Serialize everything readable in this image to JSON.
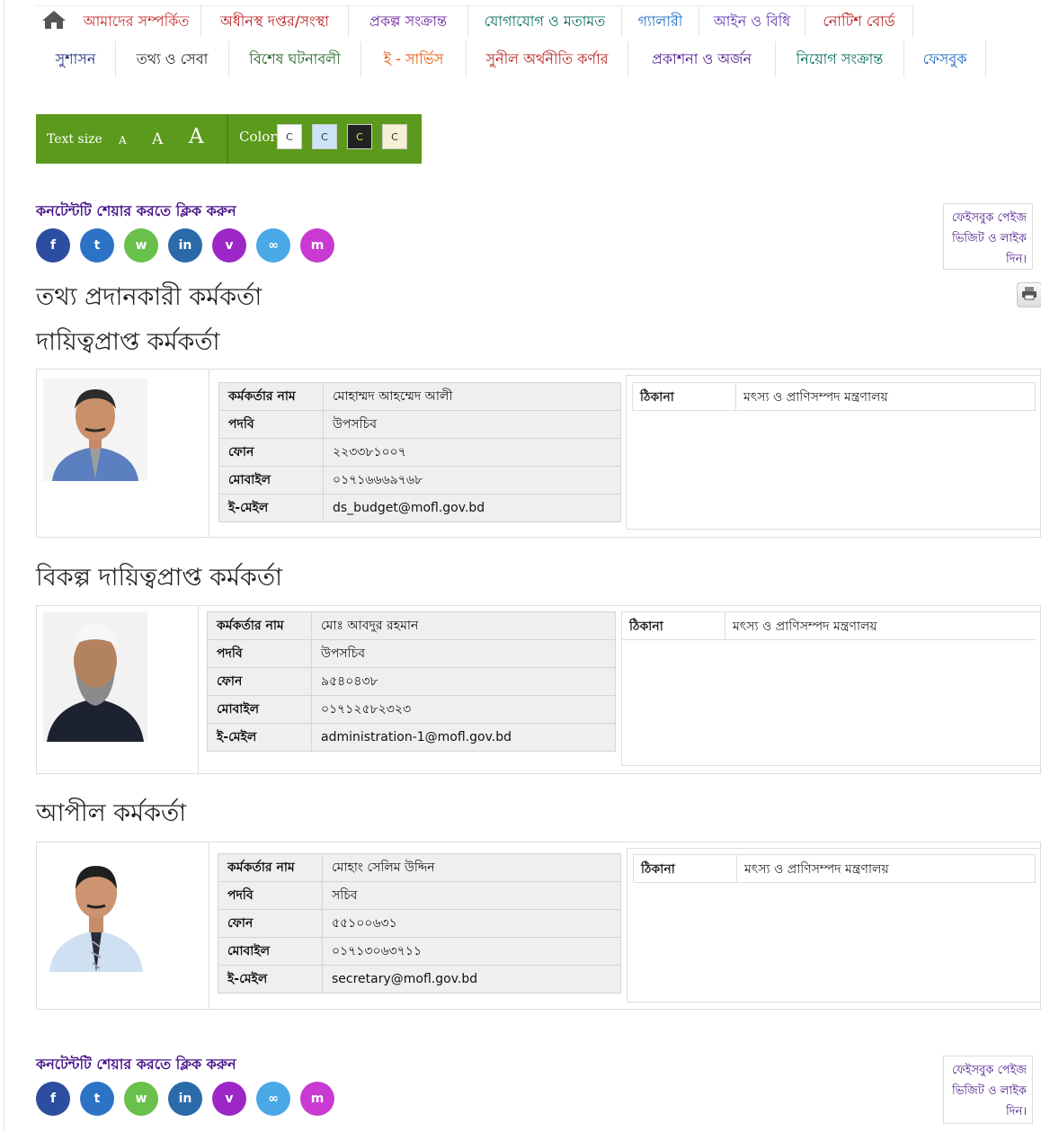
{
  "nav": {
    "row1": [
      {
        "label": "আমাদের সম্পর্কিত",
        "color": "#c62828"
      },
      {
        "label": "অধীনস্থ দপ্তর/সংস্থা",
        "color": "#b71c1c"
      },
      {
        "label": "প্রকল্প সংক্রান্ত",
        "color": "#6a1b9a"
      },
      {
        "label": "যোগাযোগ ও মতামত",
        "color": "#00695c"
      },
      {
        "label": "গ্যালারী",
        "color": "#1565c0"
      },
      {
        "label": "আইন ও বিধি",
        "color": "#5e35b1"
      },
      {
        "label": "নোটিশ বোর্ড",
        "color": "#b71c1c"
      }
    ],
    "row2": [
      {
        "label": "সুশাসন",
        "color": "#1a237e"
      },
      {
        "label": "তথ্য ও সেবা",
        "color": "#212121"
      },
      {
        "label": "বিশেষ ঘটনাবলী",
        "color": "#1b5e20"
      },
      {
        "label": "ই - সার্ভিস",
        "color": "#e65100"
      },
      {
        "label": "সুনীল অর্থনীতি কর্ণার",
        "color": "#b71c1c"
      },
      {
        "label": "প্রকাশনা ও অর্জন",
        "color": "#4a148c"
      },
      {
        "label": "নিয়োগ সংক্রান্ত",
        "color": "#00695c"
      },
      {
        "label": "ফেসবুক",
        "color": "#1565c0"
      }
    ]
  },
  "toolbar": {
    "text_size_label": "Text size",
    "size_small": "A",
    "size_medium": "A",
    "size_large": "A",
    "color_label": "Color",
    "swatches": [
      {
        "label": "C",
        "bg": "#ffffff",
        "fg": "#333333"
      },
      {
        "label": "C",
        "bg": "#cde3f8",
        "fg": "#333333"
      },
      {
        "label": "C",
        "bg": "#222222",
        "fg": "#ffeb3b"
      },
      {
        "label": "C",
        "bg": "#f5efd6",
        "fg": "#333333"
      }
    ]
  },
  "share": {
    "title": "কনটেন্টটি শেয়ার করতে ক্লিক করুন",
    "buttons": [
      {
        "icon": "facebook-icon",
        "glyph": "f",
        "color": "#2d4da0"
      },
      {
        "icon": "twitter-icon",
        "glyph": "t",
        "color": "#2c73c6"
      },
      {
        "icon": "whatsapp-icon",
        "glyph": "w",
        "color": "#69c04a"
      },
      {
        "icon": "linkedin-icon",
        "glyph": "in",
        "color": "#2a6aa9"
      },
      {
        "icon": "viber-icon",
        "glyph": "v",
        "color": "#9d26c8"
      },
      {
        "icon": "link-icon",
        "glyph": "∞",
        "color": "#4aa8e6"
      },
      {
        "icon": "messenger-icon",
        "glyph": "m",
        "color": "#c83ad1"
      }
    ],
    "fb_box": [
      "ফেইসবুক পেইজ",
      "ভিজিট ও লাইক",
      "দিন।"
    ]
  },
  "page_title": "তথ্য প্রদানকারী কর্মকর্তা",
  "sections": [
    {
      "heading": "দায়িত্বপ্রাপ্ত কর্মকর্তা",
      "rows": [
        {
          "key": "কর্মকর্তার নাম",
          "value": "মোহাম্মদ আহম্মেদ আলী"
        },
        {
          "key": "পদবি",
          "value": "উপসচিব"
        },
        {
          "key": "ফোন",
          "value": "২২৩৩৮১০০৭"
        },
        {
          "key": "মোবাইল",
          "value": "০১৭১৬৬৬৯৭৬৮"
        },
        {
          "key": "ই-মেইল",
          "value": "ds_budget@mofl.gov.bd"
        }
      ],
      "address_key": "ঠিকানা",
      "address_value": "মৎস্য ও প্রাণিসম্পদ মন্ত্রণালয়"
    },
    {
      "heading": "বিকল্প দায়িত্বপ্রাপ্ত কর্মকর্তা",
      "rows": [
        {
          "key": "কর্মকর্তার নাম",
          "value": "মোঃ আবদুর রহমান"
        },
        {
          "key": "পদবি",
          "value": "উপসচিব"
        },
        {
          "key": "ফোন",
          "value": "৯৫৪০৪৩৮"
        },
        {
          "key": "মোবাইল",
          "value": "০১৭১২৫৮২৩২৩"
        },
        {
          "key": "ই-মেইল",
          "value": "administration-1@mofl.gov.bd"
        }
      ],
      "address_key": "ঠিকানা",
      "address_value": "মৎস্য ও প্রাণিসম্পদ মন্ত্রণালয়"
    },
    {
      "heading": "আপীল কর্মকর্তা",
      "rows": [
        {
          "key": "কর্মকর্তার নাম",
          "value": "মোহাং সেলিম উদ্দিন"
        },
        {
          "key": "পদবি",
          "value": "সচিব"
        },
        {
          "key": "ফোন",
          "value": "৫৫১০০৬৩১"
        },
        {
          "key": "মোবাইল",
          "value": "০১৭১৩০৬৩৭১১"
        },
        {
          "key": "ই-মেইল",
          "value": "secretary@mofl.gov.bd"
        }
      ],
      "address_key": "ঠিকানা",
      "address_value": "মৎস্য ও প্রাণিসম্পদ মন্ত্রণালয়"
    }
  ]
}
